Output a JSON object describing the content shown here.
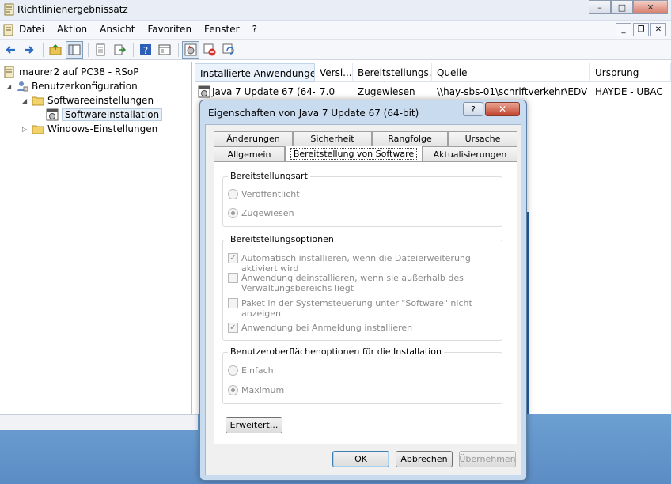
{
  "window": {
    "title": "Richtlinienergebnissatz",
    "buttons": {
      "minimize": "–",
      "maximize": "□",
      "close": "✕"
    }
  },
  "menubar": {
    "items": [
      "Datei",
      "Aktion",
      "Ansicht",
      "Favoriten",
      "Fenster",
      "?"
    ],
    "mdi_buttons": {
      "minimize": "_",
      "restore": "❐",
      "close": "✕"
    }
  },
  "toolbar": {
    "icons": [
      "back-icon",
      "forward-icon",
      "up-folder-icon",
      "show-tree-icon",
      "properties-icon",
      "export-icon",
      "help-icon",
      "view-icon",
      "java-app-icon",
      "remove-icon",
      "refresh-icon"
    ]
  },
  "tree": {
    "root": "maurer2 auf PC38 - RSoP",
    "user_config": "Benutzerkonfiguration",
    "software_settings": "Softwareeinstellungen",
    "software_install": "Softwareinstallation",
    "windows_settings": "Windows-Einstellungen"
  },
  "list": {
    "columns": [
      "Installierte Anwendungen",
      "Versi...",
      "Bereitstellungs...",
      "Quelle",
      "Ursprung"
    ],
    "rows": [
      [
        "Java 7 Update 67 (64-...",
        "7.0",
        "Zugewiesen",
        "\\\\hay-sbs-01\\schriftverkehr\\EDV ...",
        "HAYDE - UBAC"
      ]
    ]
  },
  "dialog": {
    "title": "Eigenschaften von Java 7 Update 67 (64-bit)",
    "help": "?",
    "close": "✕",
    "tabs_row1": [
      "Änderungen",
      "Sicherheit",
      "Rangfolge",
      "Ursache"
    ],
    "tabs_row2": [
      "Allgemein",
      "Bereitstellung von Software",
      "Aktualisierungen"
    ],
    "group1": {
      "title": "Bereitstellungsart",
      "options": [
        "Veröffentlicht",
        "Zugewiesen"
      ],
      "selected": 1
    },
    "group2": {
      "title": "Bereitstellungsoptionen",
      "options": [
        {
          "label": "Automatisch installieren, wenn die Dateierweiterung aktiviert wird",
          "checked": true
        },
        {
          "label": "Anwendung deinstallieren, wenn sie außerhalb des",
          "label2": "Verwaltungsbereichs liegt",
          "checked": false
        },
        {
          "label": "Paket in der Systemsteuerung unter \"Software\" nicht anzeigen",
          "checked": false
        },
        {
          "label": "Anwendung bei Anmeldung installieren",
          "checked": true
        }
      ]
    },
    "group3": {
      "title": "Benutzeroberflächenoptionen für die Installation",
      "options": [
        "Einfach",
        "Maximum"
      ],
      "selected": 1
    },
    "advanced_button": "Erweitert...",
    "ok_button": "OK",
    "cancel_button": "Abbrechen",
    "apply_button": "Übernehmen"
  }
}
